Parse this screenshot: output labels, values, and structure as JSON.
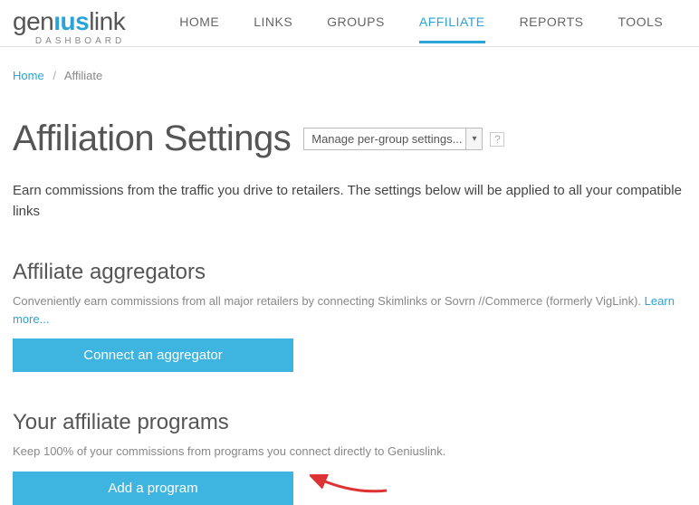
{
  "logo": {
    "part1": "gen",
    "part2": "ıus",
    "part3": "link",
    "sub": "DASHBOARD"
  },
  "nav": {
    "items": [
      "HOME",
      "LINKS",
      "GROUPS",
      "AFFILIATE",
      "REPORTS",
      "TOOLS"
    ],
    "activeIndex": 3
  },
  "breadcrumb": {
    "home": "Home",
    "current": "Affiliate"
  },
  "page": {
    "title": "Affiliation Settings",
    "select": "Manage per-group settings...",
    "help": "?",
    "desc": "Earn commissions from the traffic you drive to retailers. The settings below will be applied to all your compatible links"
  },
  "aggregators": {
    "heading": "Affiliate aggregators",
    "desc": "Conveniently earn commissions from all major retailers by connecting Skimlinks or Sovrn //Commerce (formerly VigLink). ",
    "learn": "Learn more...",
    "button": "Connect an aggregator"
  },
  "programs": {
    "heading": "Your affiliate programs",
    "desc": "Keep 100% of your commissions from programs you connect directly to Geniuslink.",
    "button": "Add a program"
  }
}
